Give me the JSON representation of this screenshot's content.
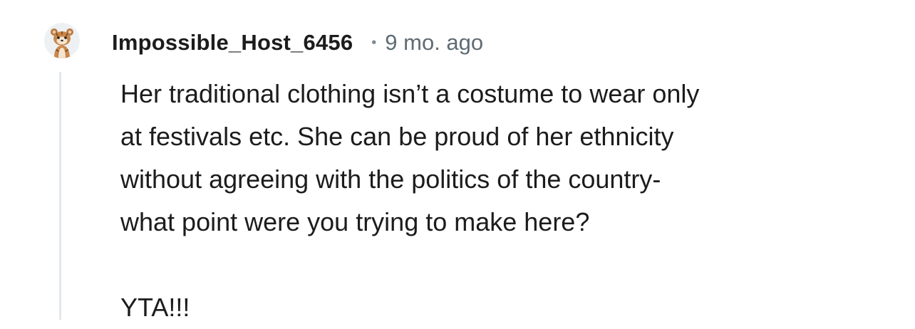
{
  "comment": {
    "author": "Impossible_Host_6456",
    "separator": "•",
    "timestamp": "9 mo. ago",
    "lines": [
      "Her traditional clothing isn’t a costume to wear only",
      "at festivals etc. She can be proud of her ethnicity",
      "without agreeing with the politics of the country-",
      "what point were you trying to make here?"
    ],
    "verdict": "YTA!!!"
  },
  "icons": {
    "avatar": "snoo-avatar-icon"
  },
  "colors": {
    "text": "#1c1c1c",
    "meta": "#5e6c74",
    "thread_line": "#e4e7ea"
  }
}
